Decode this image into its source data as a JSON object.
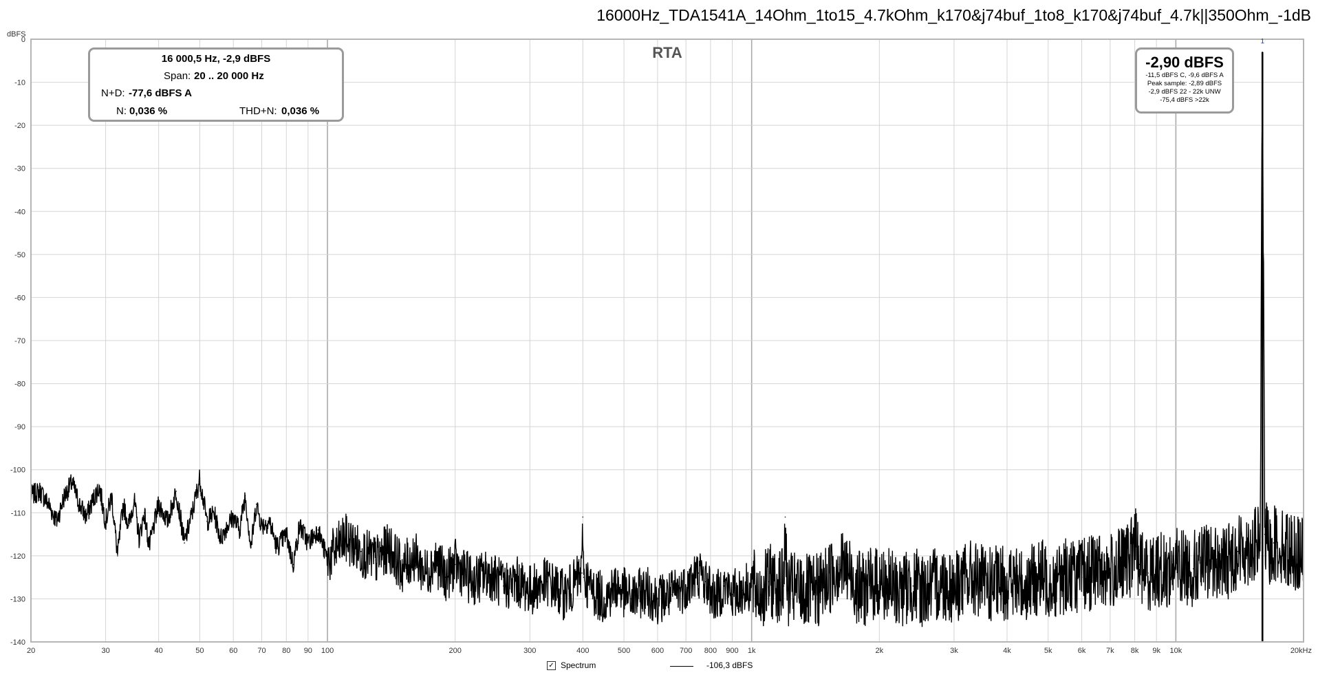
{
  "title": "16000Hz_TDA1541A_14Ohm_1to15_4.7kOhm_k170&j74buf_1to8_k170&j74buf_4.7k||350Ohm_-1dB",
  "plot_label": "RTA",
  "y_unit": "dBFS",
  "stats": {
    "header": "16 000,5 Hz, -2,9 dBFS",
    "span_label": "Span:",
    "span_value": "20 .. 20 000 Hz",
    "nd_label": "N+D:",
    "nd_value": "-77,6 dBFS A",
    "n_label": "N:",
    "n_value": "0,036 %",
    "thdn_label": "THD+N:",
    "thdn_value": "0,036 %"
  },
  "peak": {
    "value": "-2,90 dBFS",
    "lines": [
      "-11,5 dBFS C, -9,6 dBFS A",
      "Peak sample: -2,89 dBFS",
      "-2,9 dBFS 22 - 22k UNW",
      "-75,4 dBFS >22k"
    ],
    "marker": "1"
  },
  "legend": {
    "checked": true,
    "spectrum_label": "Spectrum",
    "level": "-106,3 dBFS"
  },
  "colors": {
    "trace": "#000000",
    "grid": "#d4d4d4",
    "decade": "#a9a9a9",
    "marker": "#1f3a93"
  },
  "chart_data": {
    "type": "line",
    "x_scale": "log",
    "xlim": [
      20,
      20000
    ],
    "ylim": [
      -140,
      0
    ],
    "grid": true,
    "x_ticks": [
      "20",
      "30",
      "40",
      "50",
      "60",
      "70",
      "80",
      "90",
      "100",
      "200",
      "300",
      "400",
      "500",
      "600",
      "700",
      "800",
      "900",
      "1k",
      "2k",
      "3k",
      "4k",
      "5k",
      "6k",
      "7k",
      "8k",
      "9k",
      "10k",
      "20kHz"
    ],
    "y_ticks": [
      "0",
      "-10",
      "-20",
      "-30",
      "-40",
      "-50",
      "-60",
      "-70",
      "-80",
      "-90",
      "-100",
      "-110",
      "-120",
      "-130",
      "-140"
    ],
    "series": [
      {
        "name": "Spectrum",
        "points": [
          [
            20,
            -106
          ],
          [
            21,
            -105
          ],
          [
            22,
            -108
          ],
          [
            23,
            -112
          ],
          [
            24,
            -106
          ],
          [
            25,
            -103
          ],
          [
            26,
            -108
          ],
          [
            27,
            -111
          ],
          [
            28,
            -107
          ],
          [
            29,
            -104
          ],
          [
            30,
            -112
          ],
          [
            31,
            -106
          ],
          [
            32,
            -120
          ],
          [
            33,
            -108
          ],
          [
            34,
            -113
          ],
          [
            35,
            -107
          ],
          [
            36,
            -116
          ],
          [
            37,
            -110
          ],
          [
            38,
            -118
          ],
          [
            40,
            -108
          ],
          [
            42,
            -112
          ],
          [
            44,
            -105
          ],
          [
            46,
            -117
          ],
          [
            48,
            -110
          ],
          [
            50,
            -102
          ],
          [
            52,
            -112
          ],
          [
            54,
            -110
          ],
          [
            56,
            -116
          ],
          [
            58,
            -113
          ],
          [
            60,
            -111
          ],
          [
            62,
            -114
          ],
          [
            64,
            -106
          ],
          [
            66,
            -118
          ],
          [
            68,
            -108
          ],
          [
            70,
            -113
          ],
          [
            73,
            -112
          ],
          [
            76,
            -118
          ],
          [
            80,
            -115
          ],
          [
            83,
            -122
          ],
          [
            86,
            -113
          ],
          [
            90,
            -117
          ],
          [
            95,
            -114
          ],
          [
            100,
            -121
          ],
          [
            110,
            -116
          ],
          [
            120,
            -119
          ],
          [
            130,
            -121
          ],
          [
            140,
            -118
          ],
          [
            150,
            -123
          ],
          [
            160,
            -120
          ],
          [
            170,
            -124
          ],
          [
            180,
            -121
          ],
          [
            190,
            -125
          ],
          [
            200,
            -122
          ],
          [
            220,
            -126
          ],
          [
            240,
            -124
          ],
          [
            260,
            -127
          ],
          [
            280,
            -126
          ],
          [
            300,
            -128
          ],
          [
            330,
            -126
          ],
          [
            360,
            -129
          ],
          [
            380,
            -127
          ],
          [
            398,
            -124
          ],
          [
            400,
            -111
          ],
          [
            402,
            -125
          ],
          [
            420,
            -128
          ],
          [
            450,
            -130
          ],
          [
            480,
            -127
          ],
          [
            520,
            -130
          ],
          [
            560,
            -128
          ],
          [
            600,
            -130
          ],
          [
            650,
            -129
          ],
          [
            700,
            -127
          ],
          [
            750,
            -124
          ],
          [
            780,
            -126
          ],
          [
            820,
            -130
          ],
          [
            860,
            -127
          ],
          [
            900,
            -129
          ],
          [
            950,
            -128
          ],
          [
            1000,
            -127
          ],
          [
            1050,
            -129
          ],
          [
            1100,
            -126
          ],
          [
            1190,
            -127
          ],
          [
            1200,
            -111
          ],
          [
            1210,
            -128
          ],
          [
            1300,
            -128
          ],
          [
            1400,
            -129
          ],
          [
            1500,
            -126
          ],
          [
            1600,
            -122
          ],
          [
            1700,
            -124
          ],
          [
            1800,
            -128
          ],
          [
            1900,
            -127
          ],
          [
            2000,
            -126
          ],
          [
            2200,
            -128
          ],
          [
            2400,
            -127
          ],
          [
            2600,
            -128
          ],
          [
            2800,
            -126
          ],
          [
            3000,
            -127
          ],
          [
            3300,
            -125
          ],
          [
            3600,
            -127
          ],
          [
            4000,
            -126
          ],
          [
            4400,
            -127
          ],
          [
            4800,
            -125
          ],
          [
            5200,
            -126
          ],
          [
            5600,
            -124
          ],
          [
            6000,
            -125
          ],
          [
            6500,
            -123
          ],
          [
            7000,
            -124
          ],
          [
            7500,
            -122
          ],
          [
            7800,
            -121
          ],
          [
            8000,
            -116
          ],
          [
            8200,
            -122
          ],
          [
            8600,
            -124
          ],
          [
            9000,
            -123
          ],
          [
            9500,
            -124
          ],
          [
            10000,
            -122
          ],
          [
            11000,
            -123
          ],
          [
            12000,
            -121
          ],
          [
            13000,
            -122
          ],
          [
            14000,
            -119
          ],
          [
            15000,
            -118
          ],
          [
            15800,
            -117
          ],
          [
            16000,
            -3
          ],
          [
            16200,
            -115
          ],
          [
            16600,
            -119
          ],
          [
            17000,
            -117
          ],
          [
            18000,
            -118
          ],
          [
            19000,
            -119
          ],
          [
            20000,
            -120
          ]
        ]
      }
    ]
  }
}
